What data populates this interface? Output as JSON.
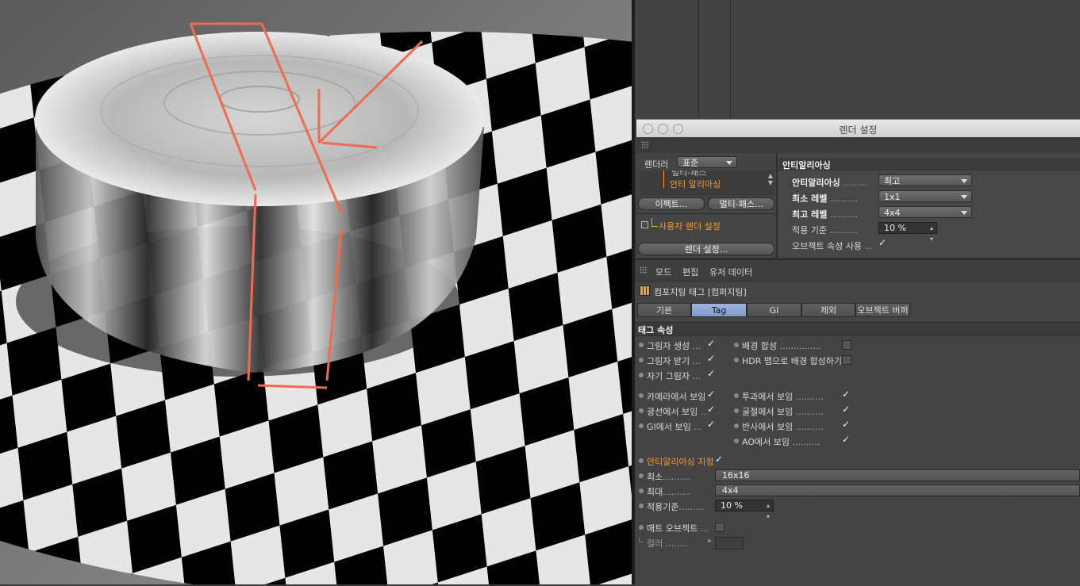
{
  "render_window": {
    "title": "렌더 설정",
    "renderer_label": "렌더러",
    "renderer_value": "표준",
    "tree_partial": "멀티-패스",
    "tree_selected": "안티 알리아싱",
    "effects_button": "이펙트...",
    "multipass_button": "멀티-패스...",
    "custom_settings": "사용자 렌더 설정",
    "render_settings_button": "렌더 설정...",
    "section_title": "안티알리아싱",
    "rows": [
      {
        "label": "안티알리아싱",
        "dots": ".........",
        "value": "최고"
      },
      {
        "label": "최소 레벨",
        "dots": "..........",
        "value": "1x1"
      },
      {
        "label": "최고 레벨",
        "dots": "..........",
        "value": "4x4"
      },
      {
        "label": "적용 기준",
        "dots": "..........",
        "value": "10 %"
      },
      {
        "label": "오브젝트 속성 사용",
        "dots": "...",
        "value": "✓"
      }
    ]
  },
  "attributes": {
    "menu": [
      "모드",
      "편집",
      "유저 데이터"
    ],
    "tag_title": "컴포지팅 태그 [컴퍼지팅]",
    "tabs": [
      "기본",
      "Tag",
      "GI",
      "제외",
      "오브젝트 버퍼"
    ],
    "active_tab": "Tag",
    "section": "태그 속성",
    "left_props": [
      {
        "label": "그림자 생성",
        "dots": "...",
        "checked": "✓"
      },
      {
        "label": "그림자 받기",
        "dots": "...",
        "checked": "✓"
      },
      {
        "label": "자기 그림자",
        "dots": "...",
        "checked": "✓"
      },
      {
        "label": "카메라에서 보임",
        "dots": "",
        "checked": "✓"
      },
      {
        "label": "광선에서 보임",
        "dots": "..",
        "checked": "✓"
      },
      {
        "label": "GI에서 보임",
        "dots": "...",
        "checked": "✓"
      }
    ],
    "right_props": [
      {
        "label": "배경 합성",
        "dots": "...............",
        "checked": ""
      },
      {
        "label": "HDR 맵으로 배경 합성하기",
        "dots": "",
        "checked": ""
      },
      {
        "label": "투과에서 보임",
        "dots": "..........",
        "checked": "✓"
      },
      {
        "label": "굴절에서 보임",
        "dots": "..........",
        "checked": "✓"
      },
      {
        "label": "반사에서 보임",
        "dots": "..........",
        "checked": "✓"
      },
      {
        "label": "AO에서 보임",
        "dots": "..........",
        "checked": "✓"
      }
    ],
    "aa_override_label": "안티알리아싱 지정",
    "aa_override_check": "✓",
    "min_label": "최소",
    "min_dots": "..........",
    "min_value": "16x16",
    "max_label": "최대",
    "max_dots": "..........",
    "max_value": "4x4",
    "threshold_label": "적용기준",
    "threshold_dots": ".........",
    "threshold_value": "10 %",
    "matte_label": "매트 오브젝트",
    "matte_dots": "...",
    "color_label": "컬러",
    "color_dots": "........"
  }
}
